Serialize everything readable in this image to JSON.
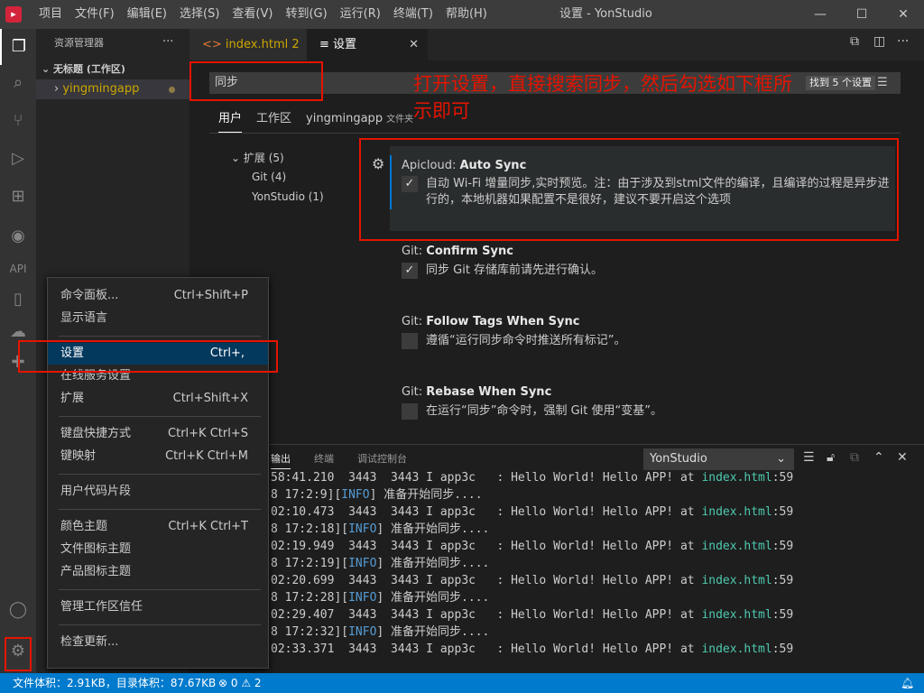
{
  "app": {
    "logo": "▸",
    "window_title": "设置 - YonStudio",
    "menu": [
      "项目",
      "文件(F)",
      "编辑(E)",
      "选择(S)",
      "查看(V)",
      "转到(G)",
      "运行(R)",
      "终端(T)",
      "帮助(H)"
    ]
  },
  "sidebar": {
    "title": "资源管理器",
    "more": "···",
    "workspace": "无标题 (工作区)",
    "folder": "yingmingapp"
  },
  "tabs": [
    {
      "label": "index.html",
      "badge": "2"
    },
    {
      "label": "设置",
      "close": "✕"
    }
  ],
  "settings": {
    "search_value": "同步",
    "found_badge": "找到 5 个设置",
    "scope_tabs": [
      "用户",
      "工作区",
      "yingmingapp"
    ],
    "scope_folder_tag": "文件夹",
    "toc": [
      {
        "label": "扩展 (5)"
      },
      {
        "label": "Git (4)"
      },
      {
        "label": "YonStudio (1)"
      }
    ],
    "items": [
      {
        "prefix": "Apicloud: ",
        "name": "Auto Sync",
        "checked": true,
        "desc_lines": [
          "自动 Wi-Fi 增量同步,实时预览。注：由于涉及到stml文件的编译，且编译的过程是异步进",
          "行的，本地机器如果配置不是很好，建议不要开启这个选项"
        ]
      },
      {
        "prefix": "Git: ",
        "name": "Confirm Sync",
        "checked": true,
        "desc_lines": [
          "同步 Git 存储库前请先进行确认。"
        ]
      },
      {
        "prefix": "Git: ",
        "name": "Follow Tags When Sync",
        "checked": false,
        "desc_lines": [
          "遵循“运行同步命令时推送所有标记”。"
        ]
      },
      {
        "prefix": "Git: ",
        "name": "Rebase When Sync",
        "checked": false,
        "desc_lines": [
          "在运行“同步”命令时，强制 Git 使用“变基”。"
        ]
      }
    ]
  },
  "annotation": "打开设置，直接搜索同步，然后勾选如下框所示即可",
  "panel": {
    "tabs": [
      "输出",
      "终端",
      "调试控制台"
    ],
    "channel": "YonStudio",
    "log": [
      {
        "pre": "58:41.210  3443  3443 I app3c   : Hello World! Hello APP! at ",
        "link": "index.html",
        "suf": ":59"
      },
      {
        "pre": "8 17:2:9][",
        "info": "INFO",
        "suf": "] 准备开始同步...."
      },
      {
        "pre": "02:10.473  3443  3443 I app3c   : Hello World! Hello APP! at ",
        "link": "index.html",
        "suf": ":59"
      },
      {
        "pre": "8 17:2:18][",
        "info": "INFO",
        "suf": "] 准备开始同步...."
      },
      {
        "pre": "02:19.949  3443  3443 I app3c   : Hello World! Hello APP! at ",
        "link": "index.html",
        "suf": ":59"
      },
      {
        "pre": "8 17:2:19][",
        "info": "INFO",
        "suf": "] 准备开始同步...."
      },
      {
        "pre": "02:20.699  3443  3443 I app3c   : Hello World! Hello APP! at ",
        "link": "index.html",
        "suf": ":59"
      },
      {
        "pre": "8 17:2:28][",
        "info": "INFO",
        "suf": "] 准备开始同步...."
      },
      {
        "pre": "02:29.407  3443  3443 I app3c   : Hello World! Hello APP! at ",
        "link": "index.html",
        "suf": ":59"
      },
      {
        "pre": "8 17:2:32][",
        "info": "INFO",
        "suf": "] 准备开始同步...."
      },
      {
        "pre": "02:33.371  3443  3443 I app3c   : Hello World! Hello APP! at ",
        "link": "index.html",
        "suf": ":59"
      }
    ]
  },
  "context_menu": [
    {
      "label": "命令面板...",
      "kb": "Ctrl+Shift+P"
    },
    {
      "label": "显示语言",
      "kb": ""
    },
    {
      "sep": true
    },
    {
      "label": "设置",
      "kb": "Ctrl+,",
      "selected": true
    },
    {
      "label": "在线服务设置",
      "kb": ""
    },
    {
      "label": "扩展",
      "kb": "Ctrl+Shift+X"
    },
    {
      "sep": true
    },
    {
      "label": "键盘快捷方式",
      "kb": "Ctrl+K Ctrl+S"
    },
    {
      "label": "键映射",
      "kb": "Ctrl+K Ctrl+M"
    },
    {
      "sep": true
    },
    {
      "label": "用户代码片段",
      "kb": ""
    },
    {
      "sep": true
    },
    {
      "label": "颜色主题",
      "kb": "Ctrl+K Ctrl+T"
    },
    {
      "label": "文件图标主题",
      "kb": ""
    },
    {
      "label": "产品图标主题",
      "kb": ""
    },
    {
      "sep": true
    },
    {
      "label": "管理工作区信任",
      "kb": ""
    },
    {
      "sep": true
    },
    {
      "label": "检查更新...",
      "kb": ""
    }
  ],
  "statusbar": {
    "size_info": "文件体积：2.91KB，目录体积：87.67KB",
    "errors": "0",
    "warnings": "2"
  },
  "colors": {
    "accent": "#007acc",
    "annotation": "#e51400",
    "selected": "#04395e"
  }
}
